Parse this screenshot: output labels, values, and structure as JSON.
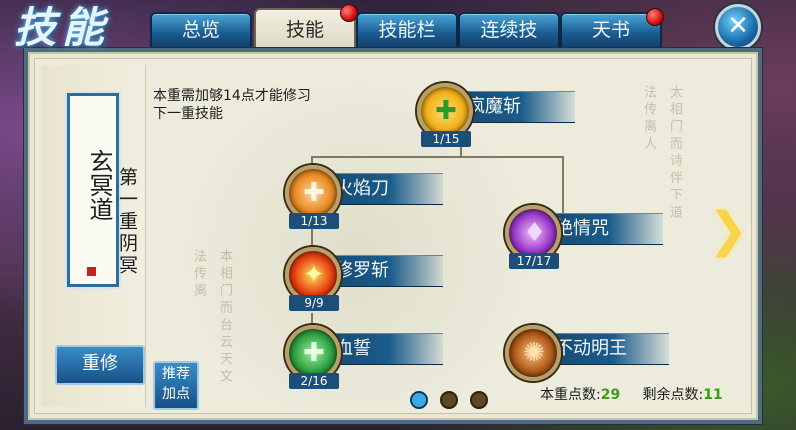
{
  "window": {
    "title": "技能"
  },
  "tabs": [
    {
      "label": "总览",
      "active": false,
      "badge": false
    },
    {
      "label": "技能",
      "active": true,
      "badge": true
    },
    {
      "label": "技能栏",
      "active": false,
      "badge": false
    },
    {
      "label": "连续技",
      "active": false,
      "badge": false
    },
    {
      "label": "天书",
      "active": false,
      "badge": true
    }
  ],
  "close_label": "✕",
  "left_panel": {
    "school_name": "玄冥道",
    "layer_title": "第一重阴冥",
    "reset_button": "重修"
  },
  "requirement_text": "本重需加够14点才能修习下一重技能",
  "recommend_button": "推荐加点",
  "skills": [
    {
      "id": "fengmozhan",
      "name": "疯魔斩",
      "count": "1/15",
      "icon": "green-figure-icon",
      "color": "#f2b018"
    },
    {
      "id": "huoyandao",
      "name": "火焰刀",
      "count": "1/13",
      "icon": "fire-blade-icon",
      "color": "#e88a20"
    },
    {
      "id": "jueqingzhou",
      "name": "绝情咒",
      "count": "17/17",
      "icon": "purple-crystal-icon",
      "color": "#9a3ac8"
    },
    {
      "id": "xiuluozhan",
      "name": "修罗斩",
      "count": "9/9",
      "icon": "flame-slash-icon",
      "color": "#e64010"
    },
    {
      "id": "xueshi",
      "name": "血誓",
      "count": "2/16",
      "icon": "green-figure-icon",
      "color": "#2ea040"
    },
    {
      "id": "budongmingwang",
      "name": "不动明王",
      "count": "",
      "icon": "bronze-guardian-icon",
      "color": "#b05a18"
    }
  ],
  "pager": {
    "pages": 3,
    "current": 1
  },
  "footer": {
    "layer_points_label": "本重点数:",
    "layer_points_value": "29",
    "remaining_points_label": "剩余点数:",
    "remaining_points_value": "11"
  }
}
